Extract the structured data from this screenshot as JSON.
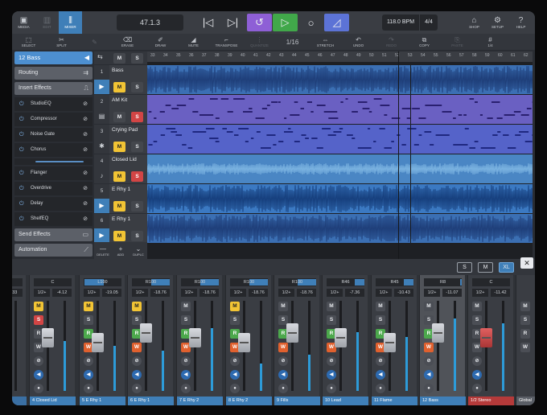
{
  "topbar": {
    "left": [
      {
        "label": "MEDIA",
        "icon": "media-icon"
      },
      {
        "label": "EDIT",
        "icon": "edit-icon"
      },
      {
        "label": "MIXER",
        "icon": "mixer-icon"
      }
    ],
    "position": "47.1.3",
    "bpm": "118.0 BPM",
    "signature": "4/4",
    "right": [
      {
        "label": "SHOP",
        "icon": "shop-icon"
      },
      {
        "label": "SETUP",
        "icon": "setup-icon"
      },
      {
        "label": "HELP",
        "icon": "help-icon"
      }
    ]
  },
  "toolbar": [
    {
      "label": "SELECT",
      "icon": "select-icon"
    },
    {
      "label": "SPLIT",
      "icon": "split-icon"
    },
    {
      "label": "",
      "icon": "pencil-icon"
    },
    {
      "label": "ERASE",
      "icon": "erase-icon"
    },
    {
      "label": "DRAW",
      "icon": "draw-icon"
    },
    {
      "label": "MUTE",
      "icon": "mute-icon"
    },
    {
      "label": "TRANSPOSE",
      "icon": "transpose-icon"
    },
    {
      "label": "QUANTIZE",
      "icon": "quantize-icon"
    },
    {
      "label": "1/16",
      "icon": "snap-icon"
    },
    {
      "label": "STRETCH",
      "icon": "stretch-icon"
    },
    {
      "label": "UNDO",
      "icon": "undo-icon"
    },
    {
      "label": "REDO",
      "icon": "redo-icon"
    },
    {
      "label": "COPY",
      "icon": "copy-icon"
    },
    {
      "label": "PASTE",
      "icon": "paste-icon"
    },
    {
      "label": "1/4",
      "icon": "grid-icon"
    }
  ],
  "sidebar": {
    "track": "12  Bass",
    "routing": "Routing",
    "insert_effects": "Insert Effects",
    "effects": [
      "StudioEQ",
      "Compressor",
      "Noise Gate",
      "Chorus",
      "Flanger",
      "Overdrive",
      "Delay",
      "ShelfEQ"
    ],
    "send_effects": "Send Effects",
    "automation": "Automation"
  },
  "tracks": [
    {
      "num": "1",
      "name": "Bass",
      "icon": "audio-icon",
      "m": true,
      "s": false
    },
    {
      "num": "2",
      "name": "AM Kit",
      "icon": "drum-icon",
      "m": false,
      "s": true
    },
    {
      "num": "3",
      "name": "Crying Pad",
      "icon": "synth-icon",
      "m": true,
      "s": false
    },
    {
      "num": "4",
      "name": "Closed Lid",
      "icon": "piano-icon",
      "m": true,
      "s": true
    },
    {
      "num": "5",
      "name": "E Rhy 1",
      "icon": "audio-icon",
      "m": true,
      "s": false
    },
    {
      "num": "6",
      "name": "E Rhy 1",
      "icon": "audio-icon",
      "m": true,
      "s": false
    }
  ],
  "bottom_tools": [
    {
      "label": "DELETE",
      "icon": "minus-icon"
    },
    {
      "label": "ADD",
      "icon": "plus-icon"
    },
    {
      "label": "DUPLC",
      "icon": "duplicate-icon"
    }
  ],
  "ruler": [
    "33",
    "34",
    "35",
    "36",
    "37",
    "38",
    "39",
    "40",
    "41",
    "42",
    "43",
    "44",
    "45",
    "46",
    "47",
    "48",
    "49",
    "50",
    "51",
    "52",
    "53",
    "54",
    "55",
    "56",
    "57",
    "58",
    "59",
    "60",
    "61",
    "62"
  ],
  "mixer_sizes": [
    "S",
    "M",
    "XL"
  ],
  "mixer_size_active": "XL",
  "strips": [
    {
      "pan": "",
      "pan_fill": 0,
      "a": "",
      "b": "3.33",
      "name": "",
      "variant": "dk"
    },
    {
      "pan": "C",
      "pan_fill": 0,
      "a": "1/2+",
      "b": "-4.12",
      "name": "4   Closed Lid",
      "m": true,
      "s": true,
      "r": false,
      "level": 0.55
    },
    {
      "pan": "L100",
      "pan_fill": 0.5,
      "a": "1/2+",
      "b": "-19.05",
      "name": "5   E Rhy 1",
      "m": true,
      "s": false,
      "r": true,
      "level": 0.5
    },
    {
      "pan": "R100",
      "pan_fill": 0.5,
      "a": "1/2+",
      "b": "-18.76",
      "name": "6   E Rhy 1",
      "m": true,
      "s": false,
      "r": true,
      "level": 0.45
    },
    {
      "pan": "R100",
      "pan_fill": 0.5,
      "a": "1/2+",
      "b": "-18.76",
      "name": "7   E Rhy 2",
      "m": false,
      "s": false,
      "r": true,
      "level": 0.7
    },
    {
      "pan": "R100",
      "pan_fill": 0.5,
      "a": "1/2+",
      "b": "-18.76",
      "name": "8   E Rhy 2",
      "m": true,
      "s": false,
      "r": true,
      "level": 0.3
    },
    {
      "pan": "R100",
      "pan_fill": 0.5,
      "a": "1/2+",
      "b": "-18.76",
      "name": "9   Fills",
      "m": false,
      "s": false,
      "r": true,
      "level": 0.4
    },
    {
      "pan": "R46",
      "pan_fill": 0.25,
      "a": "1/2+",
      "b": "-7.36",
      "name": "10   Lead",
      "m": false,
      "s": false,
      "r": true,
      "level": 0.65
    },
    {
      "pan": "R45",
      "pan_fill": 0.25,
      "a": "1/2+",
      "b": "-10.43",
      "name": "11   Flame",
      "m": false,
      "s": false,
      "r": true,
      "level": 0.6
    },
    {
      "pan": "R8",
      "pan_fill": 0.05,
      "a": "1/2+",
      "b": "-11.07",
      "name": "12   Bass",
      "m": false,
      "s": false,
      "r": true,
      "level": 0.8,
      "selected": true
    },
    {
      "pan": "C",
      "pan_fill": 0,
      "a": "1/2+",
      "b": "-11.42",
      "name": "1/2   Stereo",
      "m": false,
      "s": false,
      "r": false,
      "level": 0.75,
      "red": true
    },
    {
      "pan": "",
      "pan_fill": 0,
      "a": "",
      "b": "",
      "name": "Global",
      "global": true
    }
  ]
}
